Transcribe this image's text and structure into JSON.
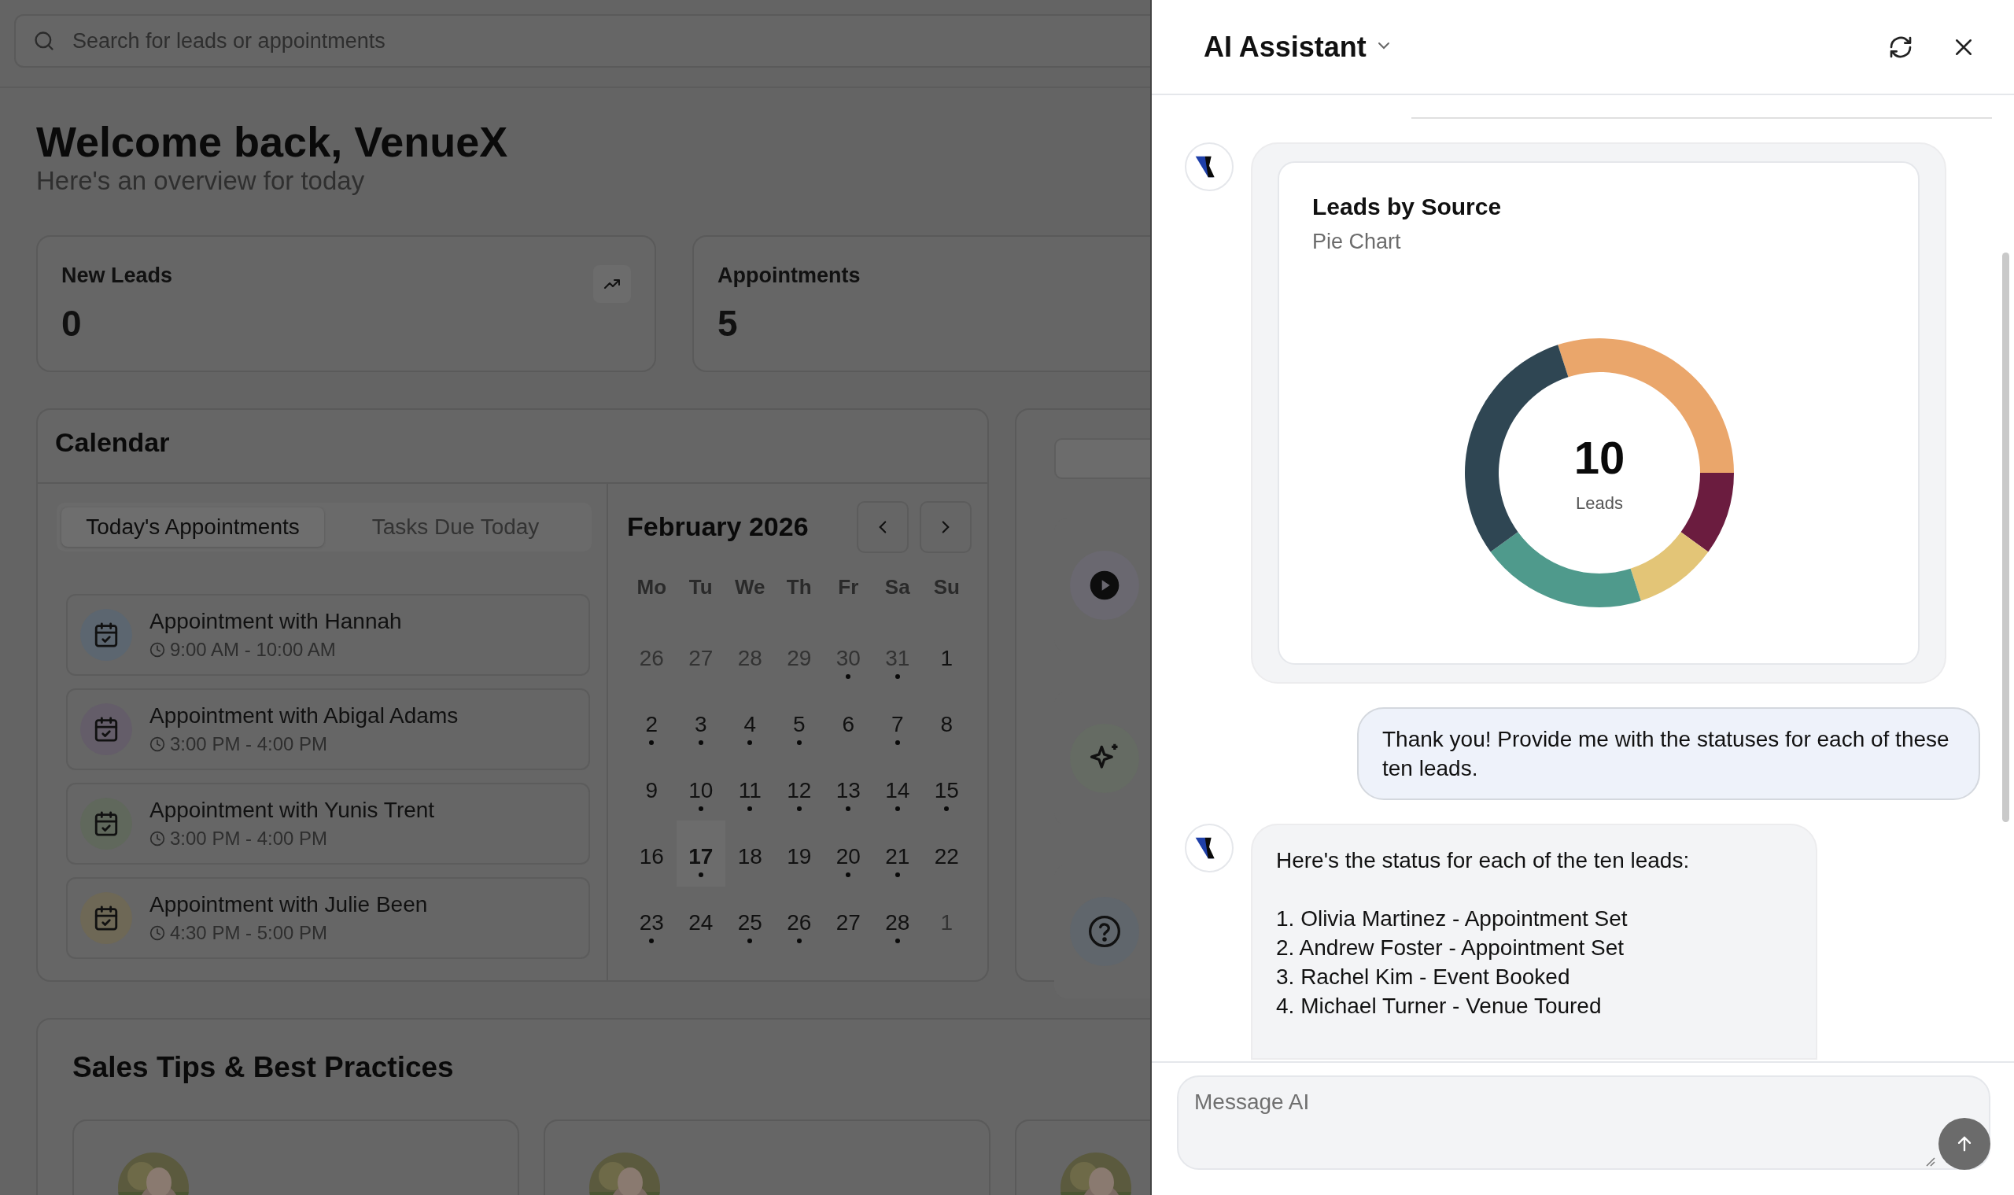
{
  "search": {
    "placeholder": "Search for leads or appointments"
  },
  "welcome": {
    "title": "Welcome back, VenueX",
    "subtitle": "Here's an overview for today"
  },
  "stats": [
    {
      "label": "New Leads",
      "value": "0",
      "kind": "trend"
    },
    {
      "label": "Appointments",
      "value": "5",
      "kind": "plain"
    }
  ],
  "calendar": {
    "title": "Calendar",
    "tabs": [
      {
        "label": "Today's Appointments",
        "selected": true
      },
      {
        "label": "Tasks Due Today",
        "selected": false
      }
    ],
    "appointments": [
      {
        "title": "Appointment with Hannah",
        "time": "9:00 AM - 10:00 AM",
        "color": "#5c6670"
      },
      {
        "title": "Appointment with Abigal Adams",
        "time": "3:00 PM - 4:00 PM",
        "color": "#645d69"
      },
      {
        "title": "Appointment with Yunis Trent",
        "time": "3:00 PM - 4:00 PM",
        "color": "#60685c"
      },
      {
        "title": "Appointment with Julie Been",
        "time": "4:30 PM - 5:00 PM",
        "color": "#6e6856"
      }
    ],
    "month": "February 2026",
    "weekdays": [
      "Mo",
      "Tu",
      "We",
      "Th",
      "Fr",
      "Sa",
      "Su"
    ],
    "weeks": [
      [
        {
          "day": "26",
          "muted": true,
          "event": false,
          "selected": false
        },
        {
          "day": "27",
          "muted": true,
          "event": false,
          "selected": false
        },
        {
          "day": "28",
          "muted": true,
          "event": false,
          "selected": false
        },
        {
          "day": "29",
          "muted": true,
          "event": false,
          "selected": false
        },
        {
          "day": "30",
          "muted": true,
          "event": true,
          "selected": false
        },
        {
          "day": "31",
          "muted": true,
          "event": true,
          "selected": false
        },
        {
          "day": "1",
          "muted": false,
          "event": false,
          "selected": false
        }
      ],
      [
        {
          "day": "2",
          "muted": false,
          "event": true,
          "selected": false
        },
        {
          "day": "3",
          "muted": false,
          "event": true,
          "selected": false
        },
        {
          "day": "4",
          "muted": false,
          "event": true,
          "selected": false
        },
        {
          "day": "5",
          "muted": false,
          "event": true,
          "selected": false
        },
        {
          "day": "6",
          "muted": false,
          "event": false,
          "selected": false
        },
        {
          "day": "7",
          "muted": false,
          "event": true,
          "selected": false
        },
        {
          "day": "8",
          "muted": false,
          "event": false,
          "selected": false
        }
      ],
      [
        {
          "day": "9",
          "muted": false,
          "event": false,
          "selected": false
        },
        {
          "day": "10",
          "muted": false,
          "event": true,
          "selected": false
        },
        {
          "day": "11",
          "muted": false,
          "event": true,
          "selected": false
        },
        {
          "day": "12",
          "muted": false,
          "event": true,
          "selected": false
        },
        {
          "day": "13",
          "muted": false,
          "event": true,
          "selected": false
        },
        {
          "day": "14",
          "muted": false,
          "event": true,
          "selected": false
        },
        {
          "day": "15",
          "muted": false,
          "event": true,
          "selected": false
        }
      ],
      [
        {
          "day": "16",
          "muted": false,
          "event": false,
          "selected": false
        },
        {
          "day": "17",
          "muted": false,
          "event": true,
          "selected": true
        },
        {
          "day": "18",
          "muted": false,
          "event": false,
          "selected": false
        },
        {
          "day": "19",
          "muted": false,
          "event": false,
          "selected": false
        },
        {
          "day": "20",
          "muted": false,
          "event": true,
          "selected": false
        },
        {
          "day": "21",
          "muted": false,
          "event": true,
          "selected": false
        },
        {
          "day": "22",
          "muted": false,
          "event": false,
          "selected": false
        }
      ],
      [
        {
          "day": "23",
          "muted": false,
          "event": true,
          "selected": false
        },
        {
          "day": "24",
          "muted": false,
          "event": false,
          "selected": false
        },
        {
          "day": "25",
          "muted": false,
          "event": true,
          "selected": false
        },
        {
          "day": "26",
          "muted": false,
          "event": true,
          "selected": false
        },
        {
          "day": "27",
          "muted": false,
          "event": false,
          "selected": false
        },
        {
          "day": "28",
          "muted": false,
          "event": true,
          "selected": false
        },
        {
          "day": "1",
          "muted": true,
          "event": false,
          "selected": false
        }
      ]
    ]
  },
  "sales_tips": {
    "title": "Sales Tips & Best Practices"
  },
  "assistant": {
    "title": "AI Assistant",
    "messages": [
      {
        "kind": "chart",
        "chart_title": "Leads by Source",
        "chart_subtitle": "Pie Chart",
        "total": "10",
        "total_label": "Leads"
      },
      {
        "kind": "user_text",
        "text": "Thank you! Provide me with the statuses for each of these ten leads."
      },
      {
        "kind": "list",
        "intro": "Here's the status for each of the ten leads:",
        "items": [
          "1. Olivia Martinez - Appointment Set",
          "2. Andrew Foster - Appointment Set",
          "3. Rachel Kim - Event Booked",
          "4. Michael Turner - Venue Toured"
        ]
      }
    ],
    "composer": {
      "placeholder": "Message AI"
    }
  }
}
